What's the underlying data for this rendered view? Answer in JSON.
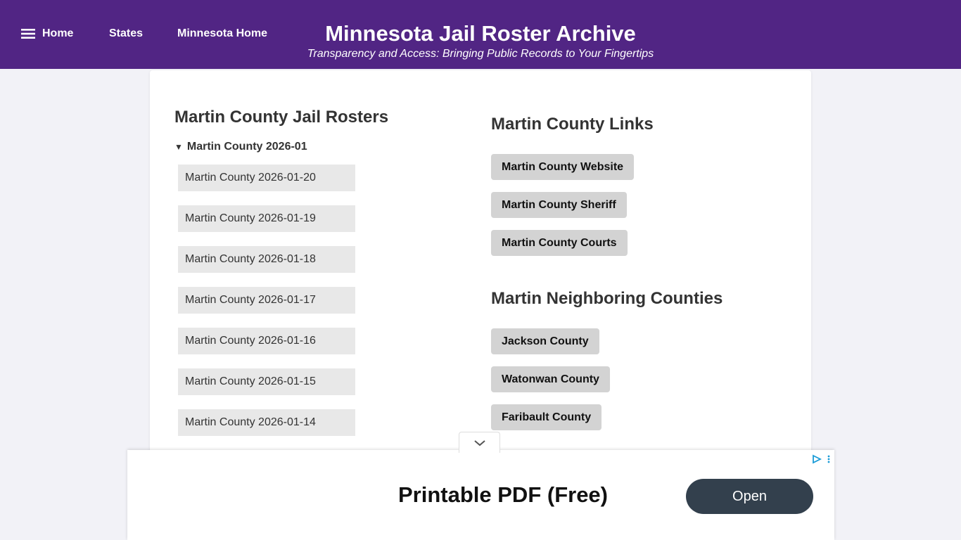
{
  "nav": {
    "home": "Home",
    "states": "States",
    "state_home": "Minnesota Home"
  },
  "header": {
    "title": "Minnesota Jail Roster Archive",
    "subtitle": "Transparency and Access: Bringing Public Records to Your Fingertips"
  },
  "rosters": {
    "title": "Martin County Jail Rosters",
    "group_label": "Martin County 2026-01",
    "items": [
      "Martin County 2026-01-20",
      "Martin County 2026-01-19",
      "Martin County 2026-01-18",
      "Martin County 2026-01-17",
      "Martin County 2026-01-16",
      "Martin County 2026-01-15",
      "Martin County 2026-01-14"
    ]
  },
  "links": {
    "title": "Martin County Links",
    "items": [
      "Martin County Website",
      "Martin County Sheriff",
      "Martin County Courts"
    ]
  },
  "neighbors": {
    "title": "Martin Neighboring Counties",
    "items": [
      "Jackson County",
      "Watonwan County",
      "Faribault County"
    ]
  },
  "ad": {
    "headline": "Printable PDF (Free)",
    "button": "Open"
  },
  "colors": {
    "header_bg": "#512584",
    "page_bg": "#f2f2f7",
    "pill_bg": "#d3d3d3",
    "roster_bg": "#e8e8e8",
    "ad_button_bg": "#33404d"
  },
  "icons": {
    "menu": "hamburger-menu-icon",
    "disclosure": "triangle-down-icon",
    "ad_collapse": "chevron-down-icon",
    "ad_choices": "ad-choices-icon",
    "ad_options": "vertical-dots-icon"
  }
}
